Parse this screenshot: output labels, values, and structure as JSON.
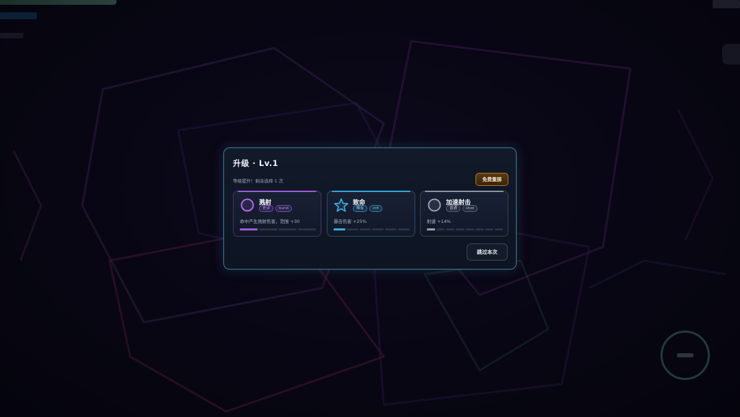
{
  "upgrade_modal": {
    "title": "升级 · Lv.1",
    "subtitle": "等级提升！剩余选择 1 次",
    "reroll_label": "免费重掷",
    "skip_label": "跳过本次",
    "cards": [
      {
        "name": "溅射",
        "icon": "circle-icon",
        "rarity": "史诗",
        "tag": "burst",
        "description": "命中产生溅射伤害，范围 +30",
        "accent_color": "#a05ad8",
        "level_filled": 1,
        "level_max": 4
      },
      {
        "name": "致命",
        "icon": "star-icon",
        "rarity": "稀有",
        "tag": "crit",
        "description": "暴击伤害 +25%",
        "accent_color": "#3ab0e2",
        "level_filled": 1,
        "level_max": 6
      },
      {
        "name": "加速射击",
        "icon": "circle-icon",
        "rarity": "普通",
        "tag": "shot",
        "description": "射速 +14%",
        "accent_color": "#9aa2b4",
        "level_filled": 1,
        "level_max": 8
      }
    ]
  }
}
